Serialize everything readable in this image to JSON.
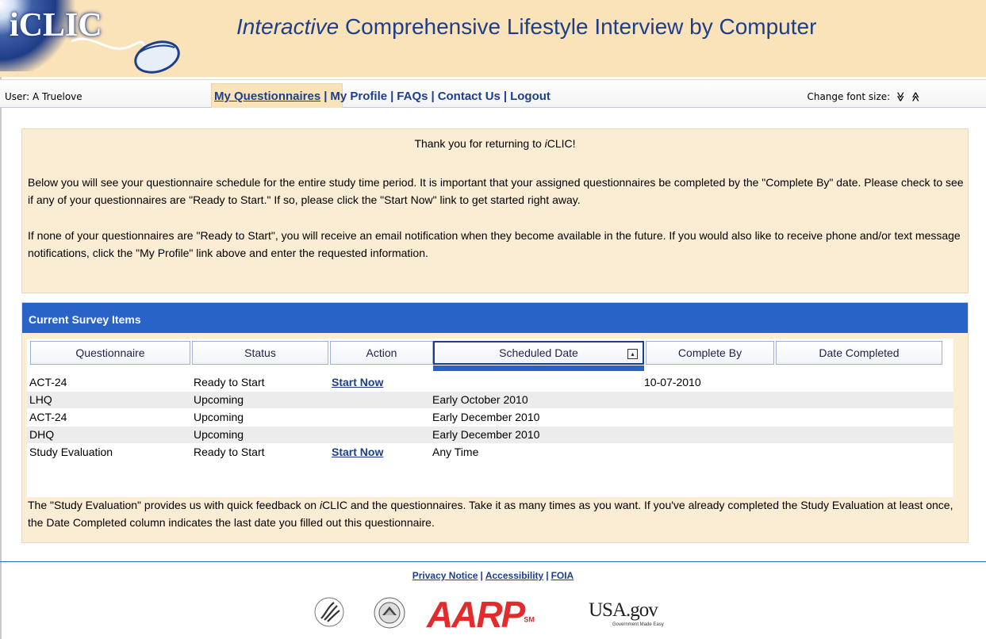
{
  "header": {
    "logo_text": "iCLIC",
    "title_italic": "Interactive",
    "title_rest": " Comprehensive Lifestyle Interview by Computer"
  },
  "nav": {
    "user": "User: A Truelove",
    "links": [
      "My Questionnaires",
      "My Profile",
      "FAQs",
      "Contact Us",
      "Logout"
    ],
    "separator": "|",
    "font_size_label": "Change font size:",
    "font_decrease": "≫",
    "font_increase": "≪"
  },
  "intro": {
    "title_prefix": "Thank you for returning to ",
    "title_brand": "i",
    "title_suffix": "CLIC!",
    "paragraph1": "Below you will see your questionnaire schedule for the entire study time period. It is important that your assigned questionnaires be completed by the \"Complete By\" date. Please check to see if any of your questionnaires are \"Ready to Start.\" If so, please click the \"Start Now\" link to get started right away.",
    "paragraph2": "If none of your questionnaires are \"Ready to Start\", you will receive an email notification when they become available in the future. If you would also like to receive phone and/or text message notifications, click the \"My Profile\" link above and enter the requested information."
  },
  "survey": {
    "heading": "Current Survey Items",
    "columns": [
      "Questionnaire",
      "Status",
      "Action",
      "Scheduled Date",
      "Complete By",
      "Date Completed"
    ],
    "sort_icon": "▴",
    "rows": [
      {
        "questionnaire": "ACT-24",
        "status": "Ready to Start",
        "action": "Start Now",
        "scheduled": "",
        "complete_by": "10-07-2010",
        "completed": ""
      },
      {
        "questionnaire": "LHQ",
        "status": "Upcoming",
        "action": "",
        "scheduled": "Early October 2010",
        "complete_by": "",
        "completed": ""
      },
      {
        "questionnaire": "ACT-24",
        "status": "Upcoming",
        "action": "",
        "scheduled": "Early December 2010",
        "complete_by": "",
        "completed": ""
      },
      {
        "questionnaire": "DHQ",
        "status": "Upcoming",
        "action": "",
        "scheduled": "Early December 2010",
        "complete_by": "",
        "completed": ""
      },
      {
        "questionnaire": "Study Evaluation",
        "status": "Ready to Start",
        "action": "Start Now",
        "scheduled": "Any Time",
        "complete_by": "",
        "completed": ""
      }
    ],
    "note_prefix": "The \"Study Evaluation\" provides us with quick feedback on ",
    "note_brand": "i",
    "note_suffix": "CLIC and the questionnaires. Take it as many times as you want. If you've already completed the Study Evaluation at least once, the Date Completed column indicates the last date you filled out this questionnaire."
  },
  "footer": {
    "links": [
      "Privacy Notice",
      "Accessibility",
      "FOIA"
    ],
    "separator": "|",
    "logos": {
      "hhs": "hhs-eagle-logo",
      "nih": "nih-seal-logo",
      "aarp": "AARP",
      "aarp_mark": "SM",
      "usagov": "USA.gov",
      "usagov_tagline": "Government Made Easy"
    }
  },
  "colors": {
    "brand_blue": "#1c3e8b",
    "header_bg": "#fbe3b9",
    "panel_bg": "#fbecd4",
    "table_head": "#2a63c7",
    "aarp_red": "#e32b2b"
  }
}
